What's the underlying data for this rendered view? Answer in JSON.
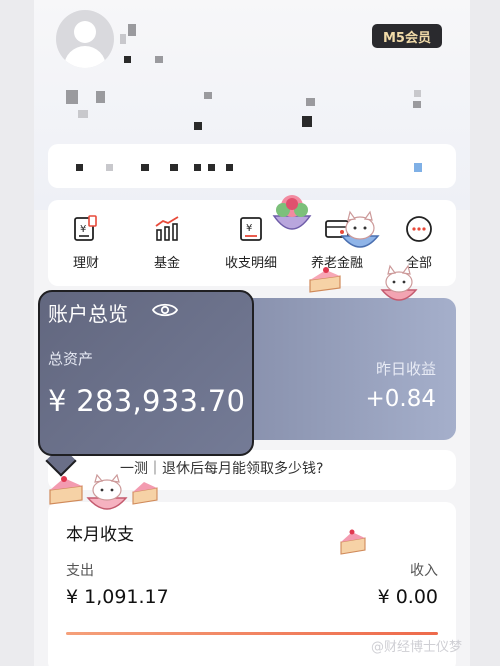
{
  "header": {
    "badge_label": "M5会员"
  },
  "quick_menu": [
    {
      "label": "理财",
      "icon": "wealth-icon"
    },
    {
      "label": "基金",
      "icon": "fund-chart-icon"
    },
    {
      "label": "收支明细",
      "icon": "bill-detail-icon"
    },
    {
      "label": "养老金融",
      "icon": "pension-card-icon"
    },
    {
      "label": "全部",
      "icon": "more-dots-icon"
    }
  ],
  "assets": {
    "title": "账户总览",
    "total_label": "总资产",
    "total_value": "¥ 283,933.70",
    "yesterday_label": "昨日收益",
    "yesterday_value": "+0.84"
  },
  "promo": {
    "text": "一测｜退休后每月能领取多少钱?"
  },
  "month_summary": {
    "title": "本月收支",
    "expense_label": "支出",
    "expense_value": "¥ 1,091.17",
    "income_label": "收入",
    "income_value": "¥ 0.00"
  },
  "watermark": "@财经博士仪梦",
  "colors": {
    "card_gradient_start": "#6f7492",
    "card_gradient_end": "#a5afcb",
    "accent_orange": "#ee6a4b",
    "badge_bg": "#2a2a2e",
    "badge_text": "#f1dba9"
  }
}
